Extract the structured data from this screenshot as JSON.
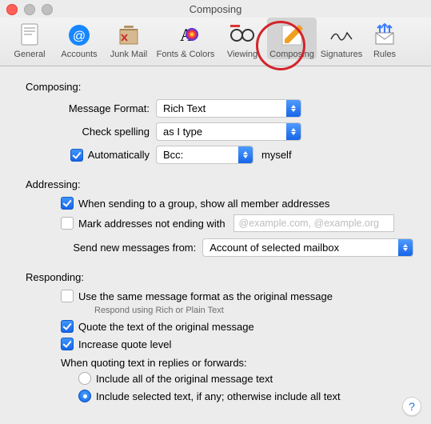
{
  "window": {
    "title": "Composing"
  },
  "toolbar": {
    "items": [
      {
        "label": "General"
      },
      {
        "label": "Accounts"
      },
      {
        "label": "Junk Mail"
      },
      {
        "label": "Fonts & Colors"
      },
      {
        "label": "Viewing"
      },
      {
        "label": "Composing"
      },
      {
        "label": "Signatures"
      },
      {
        "label": "Rules"
      }
    ],
    "selected_index": 5
  },
  "sections": {
    "composing": {
      "title": "Composing:",
      "message_format_label": "Message Format:",
      "message_format_value": "Rich Text",
      "check_spelling_label": "Check spelling",
      "check_spelling_value": "as I type",
      "auto_checked": true,
      "auto_label": "Automatically",
      "auto_field_value": "Bcc:",
      "auto_suffix": "myself"
    },
    "addressing": {
      "title": "Addressing:",
      "group_checked": true,
      "group_label": "When sending to a group, show all member addresses",
      "mark_checked": false,
      "mark_label": "Mark addresses not ending with",
      "mark_placeholder": "@example.com, @example.org",
      "send_from_label": "Send new messages from:",
      "send_from_value": "Account of selected mailbox"
    },
    "responding": {
      "title": "Responding:",
      "same_format_checked": false,
      "same_format_label": "Use the same message format as the original message",
      "same_format_sub": "Respond using Rich or Plain Text",
      "quote_checked": true,
      "quote_label": "Quote the text of the original message",
      "increase_checked": true,
      "increase_label": "Increase quote level",
      "when_quoting_label": "When quoting text in replies or forwards:",
      "radio_all_label": "Include all of the original message text",
      "radio_selected_label": "Include selected text, if any; otherwise include all text",
      "radio_selected_index": 1
    }
  },
  "help": "?"
}
